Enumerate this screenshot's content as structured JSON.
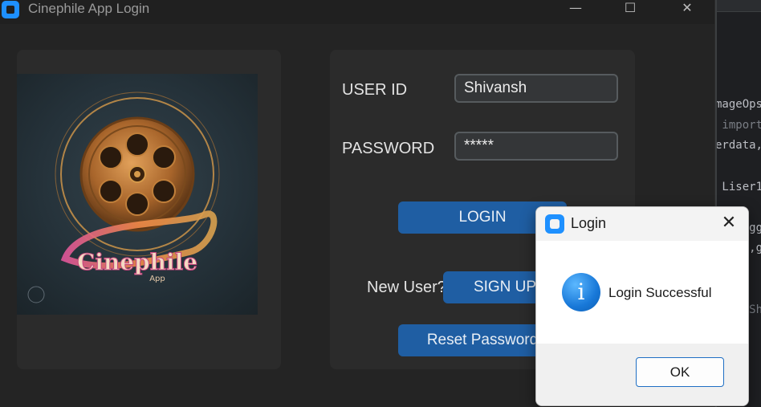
{
  "window": {
    "title": "Cinephile App Login",
    "minimize_glyph": "—",
    "maximize_glyph": "☐",
    "close_glyph": "✕"
  },
  "poster": {
    "logo_text": "Cinephile",
    "logo_subtext": "App",
    "icon": "film-reel-icon"
  },
  "form": {
    "user_id_label": "USER ID",
    "user_id_value": "Shivansh",
    "password_label": "PASSWORD",
    "password_value": "*****",
    "login_button": "LOGIN",
    "new_user_label": "New User?",
    "signup_button": "SIGN UP",
    "reset_button": "Reset Password"
  },
  "background_editor": {
    "lines": [
      {
        "text": "mageOps",
        "dim": false
      },
      {
        "text": "import",
        "dim": true
      },
      {
        "text": "erdata,",
        "dim": false
      },
      {
        "text": "Liser1",
        "dim": false
      },
      {
        "text": "gg",
        "dim": false
      },
      {
        "text": ",g",
        "dim": false
      },
      {
        "text": "Sh",
        "dim": true
      }
    ]
  },
  "dialog": {
    "title": "Login",
    "close_glyph": "✕",
    "icon": "info-icon",
    "message": "Login Successful",
    "ok_button": "OK"
  },
  "colors": {
    "accent_button": "#1f5ea3",
    "app_icon": "#1e90ff",
    "window_background": "#242424",
    "card_background": "#2b2b2b"
  }
}
